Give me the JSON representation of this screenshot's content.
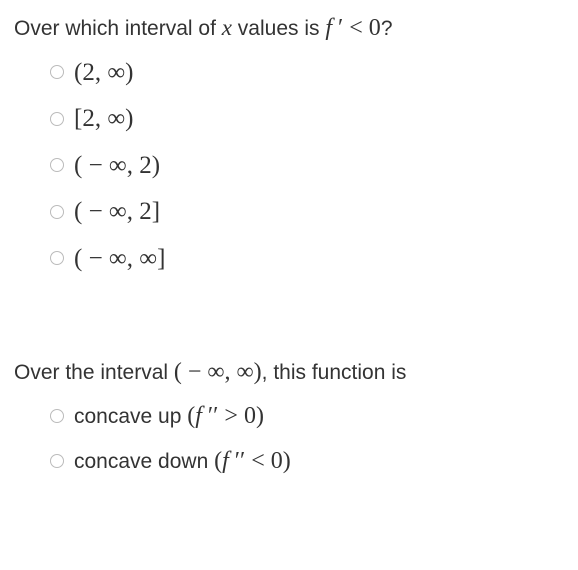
{
  "question1": {
    "prefix": "Over which interval of ",
    "var": "x",
    "middle": " values is ",
    "expr": "f ′ < 0",
    "suffix": "?",
    "options": [
      "(2, ∞)",
      "[2, ∞)",
      "( − ∞, 2)",
      "( − ∞, 2]",
      "( − ∞, ∞]"
    ]
  },
  "question2": {
    "prefix": "Over the interval ",
    "interval": "( − ∞, ∞)",
    "suffix": ", this function is",
    "options": [
      {
        "text": "concave up ",
        "math": "(f ′′ > 0)"
      },
      {
        "text": "concave down ",
        "math": "(f ′′ < 0)"
      }
    ]
  }
}
